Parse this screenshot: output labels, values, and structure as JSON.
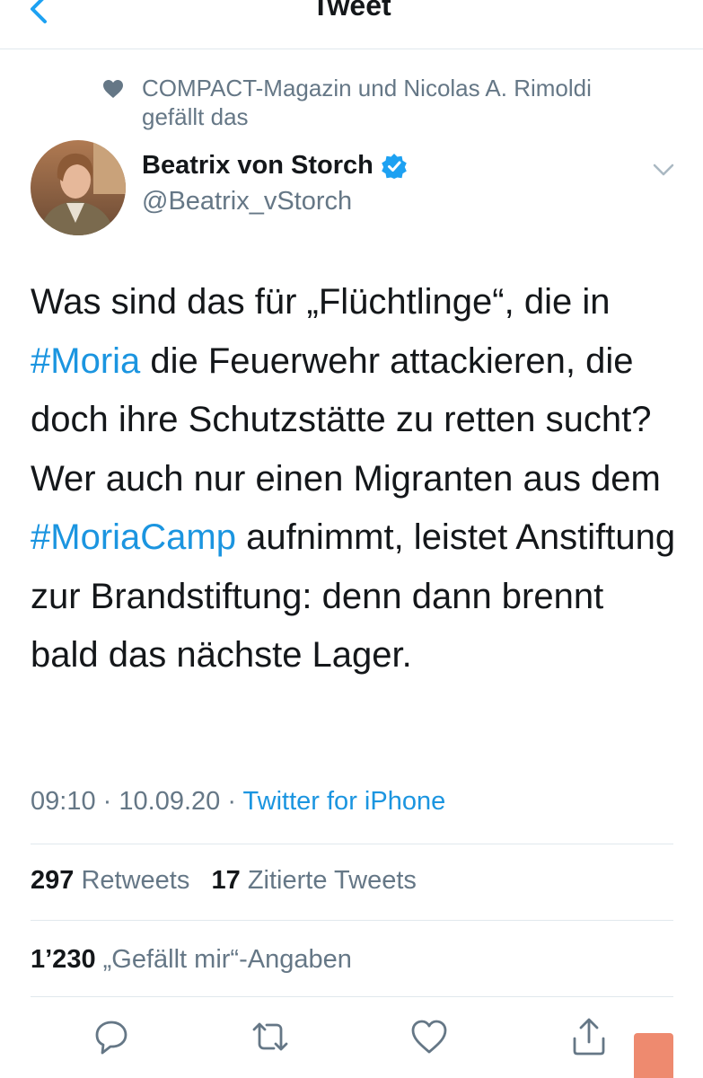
{
  "header": {
    "title": "Tweet",
    "back_icon": "chevron-left-icon"
  },
  "social_context": {
    "icon": "heart-icon",
    "text": "COMPACT-Magazin und Nicolas A. Rimoldi gefällt das"
  },
  "author": {
    "name": "Beatrix von Storch",
    "handle": "@Beatrix_vStorch",
    "verified": true
  },
  "tweet": {
    "text_parts": [
      "Was sind das für „Flüchtlinge“, die in ",
      "#Moria",
      " die Feuerwehr attackieren, die doch ihre Schutzstätte zu retten sucht? Wer auch nur einen Migranten aus dem ",
      "#MoriaCamp",
      " aufnimmt, leistet Anstiftung zur Brandstiftung: denn dann brennt bald das nächste Lager."
    ]
  },
  "meta": {
    "time": "09:10",
    "date": "10.09.20",
    "separator": "·",
    "source": "Twitter for iPhone"
  },
  "stats": {
    "retweets_count": "297",
    "retweets_label": "Retweets",
    "quotes_count": "17",
    "quotes_label": "Zitierte Tweets",
    "likes_count": "1’230",
    "likes_label": "„Gefällt mir“-Angaben"
  },
  "actions": [
    "reply-icon",
    "retweet-icon",
    "like-icon",
    "share-icon"
  ],
  "colors": {
    "link": "#1b95e0",
    "muted": "#657786",
    "text": "#14171a",
    "divider": "#e1e8ed"
  }
}
